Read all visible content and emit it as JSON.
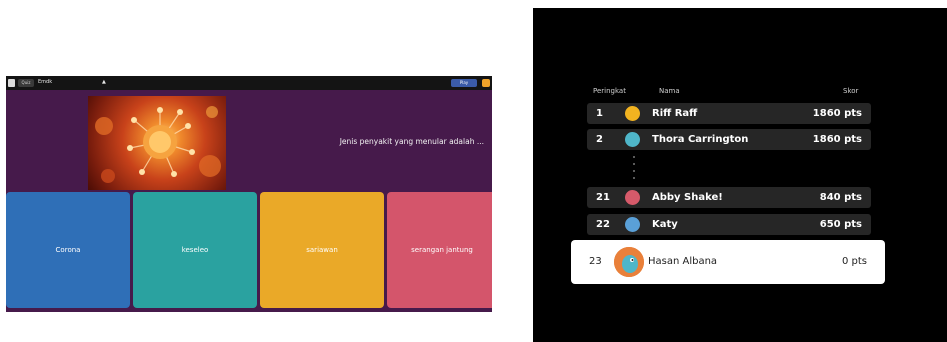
{
  "quiz": {
    "topbar": {
      "menu_label": "Quiz",
      "field_text": "Emdk",
      "field_extra": "▲",
      "play_label": "Play"
    },
    "image_icon": "virus-image",
    "question": "Jenis penyakit yang menular adalah ...",
    "answers": [
      {
        "label": "Corona",
        "color": "#2f6fb7"
      },
      {
        "label": "keseleo",
        "color": "#2aa2a0"
      },
      {
        "label": "sariawan",
        "color": "#eaa928"
      },
      {
        "label": "serangan jantung",
        "color": "#d4556b"
      }
    ],
    "background_color": "#461a4b"
  },
  "leaderboard": {
    "headers": {
      "rank": "Peringkat",
      "name": "Nama",
      "score": "Skor"
    },
    "rows": [
      {
        "rank": "1",
        "name": "Riff Raff",
        "score": "1860 pts",
        "avatar_color": "#f2b320"
      },
      {
        "rank": "2",
        "name": "Thora Carrington",
        "score": "1860 pts",
        "avatar_color": "#4fb6c9"
      },
      {
        "rank": "21",
        "name": "Abby Shake!",
        "score": "840 pts",
        "avatar_color": "#d65a6a"
      },
      {
        "rank": "22",
        "name": "Katy",
        "score": "650 pts",
        "avatar_color": "#5aa0d8"
      }
    ],
    "current_player": {
      "rank": "23",
      "name": "Hasan Albana",
      "score": "0 pts",
      "avatar_color": "#e9803a"
    },
    "background_color": "#000000"
  }
}
